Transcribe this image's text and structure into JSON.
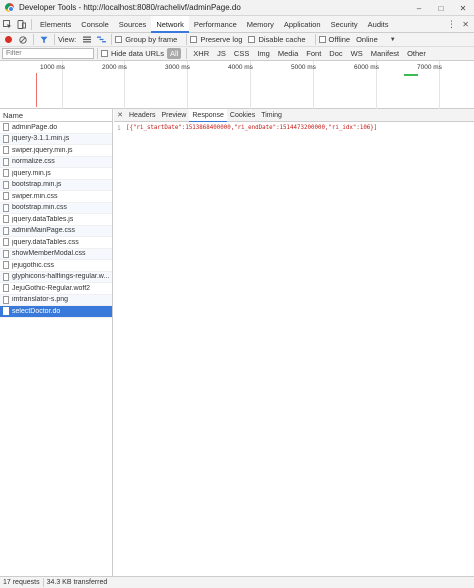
{
  "window": {
    "title": "Developer Tools - http://localhost:8080/rachelivf/adminPage.do",
    "minimize": "–",
    "maximize": "□",
    "close": "✕"
  },
  "panels": {
    "tabs": [
      "Elements",
      "Console",
      "Sources",
      "Network",
      "Performance",
      "Memory",
      "Application",
      "Security",
      "Audits"
    ],
    "active": "Network",
    "more": "⋮",
    "close": "✕"
  },
  "toolbar": {
    "view_label": "View:",
    "group_by_frame": "Group by frame",
    "preserve_log": "Preserve log",
    "disable_cache": "Disable cache",
    "offline": "Offline",
    "online": "Online",
    "throttle_caret": "▼"
  },
  "filter": {
    "placeholder": "Filter",
    "hide_data_urls": "Hide data URLs",
    "types": [
      "All",
      "XHR",
      "JS",
      "CSS",
      "Img",
      "Media",
      "Font",
      "Doc",
      "WS",
      "Manifest",
      "Other"
    ],
    "active_type": "All"
  },
  "timeline": {
    "ticks": [
      "1000 ms",
      "2000 ms",
      "3000 ms",
      "4000 ms",
      "5000 ms",
      "6000 ms",
      "7000 ms"
    ]
  },
  "requests": {
    "header": "Name",
    "items": [
      "adminPage.do",
      "jquery-3.1.1.min.js",
      "swiper.jquery.min.js",
      "normalize.css",
      "jquery.min.js",
      "bootstrap.min.js",
      "swiper.min.css",
      "bootstrap.min.css",
      "jquery.dataTables.js",
      "adminMainPage.css",
      "jquery.dataTables.css",
      "showMemberModal.css",
      "jejugothic.css",
      "glyphicons-halflings-regular.w...",
      "JejuGothic-Regular.woff2",
      "imtranslator-s.png",
      "selectDoctor.do"
    ],
    "selected": "selectDoctor.do"
  },
  "detail": {
    "close": "✕",
    "tabs": [
      "Headers",
      "Preview",
      "Response",
      "Cookies",
      "Timing"
    ],
    "active": "Response",
    "line_no": "1",
    "response_text": "[{\"ri_startDate\":1513868400000,\"ri_endDate\":1514473200000,\"ri_idx\":106}]"
  },
  "status": {
    "requests": "17 requests",
    "transferred": "34.3 KB transferred"
  },
  "colors": {
    "accent": "#3879d9",
    "record": "#d93025",
    "response_text": "#c41a16"
  }
}
